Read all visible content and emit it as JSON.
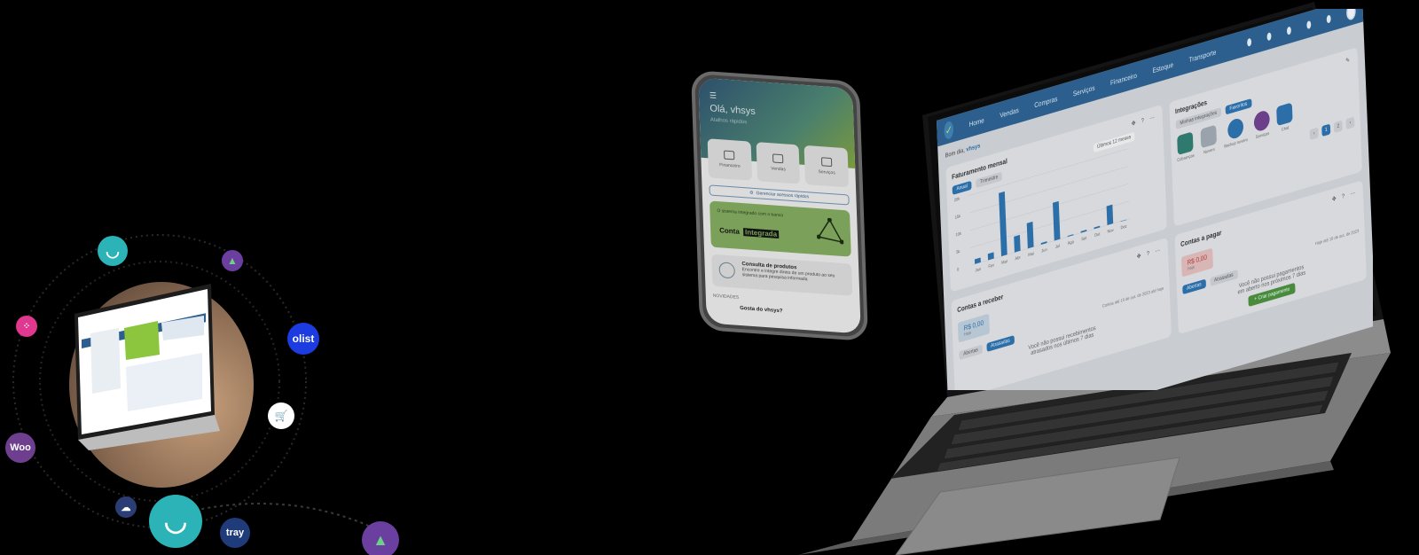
{
  "left_cluster": {
    "badges": [
      {
        "name": "unico-small-badge",
        "label": "",
        "color": "#2bb3b8"
      },
      {
        "name": "green-arrow-small-badge",
        "label": "",
        "color": "#6b3fa0"
      },
      {
        "name": "pink-dots-badge",
        "label": "",
        "color": "#e0388f"
      },
      {
        "name": "olist-badge",
        "label": "olist",
        "color": "#1c3be0"
      },
      {
        "name": "cart-badge",
        "label": "",
        "color": "#ffffff"
      },
      {
        "name": "woo-badge",
        "label": "Woo",
        "color": "#6f3f8f"
      },
      {
        "name": "cloud-badge",
        "label": "",
        "color": "#2b3d75"
      },
      {
        "name": "unico-large-badge",
        "label": "",
        "color": "#2bb3b8"
      },
      {
        "name": "tray-badge",
        "label": "tray",
        "color": "#1f3b7a"
      },
      {
        "name": "green-arrow-large-badge",
        "label": "",
        "color": "#6b3fa0"
      }
    ]
  },
  "phone": {
    "greeting": "Olá, vhsys",
    "subtitle": "Atalhos rápidos",
    "tiles": [
      "Financeiro",
      "Vendas",
      "Serviços"
    ],
    "shortcut_button": "Gerenciar acessos rápidos",
    "banner_small": "O sistema integrado com o banco",
    "banner_big_prefix": "Conta",
    "banner_big_highlight": "Integrada",
    "card_title": "Consulta de produtos",
    "card_text": "Encontre e integre direto de um produto ao seu sistema para pesquisa informada",
    "footer_label": "NOVIDADES",
    "footer_title": "Gosta do vhsys?"
  },
  "laptop": {
    "nav": [
      "Home",
      "Vendas",
      "Compras",
      "Serviços",
      "Financeiro",
      "Estoque",
      "Transporte"
    ],
    "greeting_prefix": "Bom dia,",
    "greeting_name": "vhsys",
    "billing": {
      "title": "Faturamento mensal",
      "filter": "Últimos 12 meses",
      "tabs": [
        "Anual",
        "Trimestre"
      ],
      "y_ticks": [
        "20k",
        "15k",
        "10k",
        "5k",
        "0"
      ],
      "x_ticks": [
        "Jan",
        "Fev",
        "Mar",
        "Abr",
        "Mai",
        "Jun",
        "Jul",
        "Ago",
        "Set",
        "Out",
        "Nov",
        "Dez"
      ]
    },
    "integrations": {
      "title": "Integrações",
      "tabs": [
        "Minhas integrações",
        "Favoritos"
      ],
      "items": [
        "Cobranças",
        "Nuvem",
        "Backup nuvem",
        "Serviços",
        "Chat"
      ],
      "pages": [
        "1",
        "2"
      ]
    },
    "receivables": {
      "title": "Contas a receber",
      "value": "R$ 0,00",
      "value_label": "Hoje",
      "tabs": [
        "Abertas",
        "Atrasadas"
      ],
      "period": "Contas até 19 de out. de 2023 até hoje",
      "empty_line1": "Você não possui recebimentos",
      "empty_line2": "atrasados nos últimos 7 dias"
    },
    "payables": {
      "title": "Contas a pagar",
      "value": "R$ 0,00",
      "value_label": "Hoje",
      "tabs": [
        "Abertas",
        "Atrasadas"
      ],
      "period": "Hoje até 19 de out. de 2023",
      "empty_line1": "Você não possui pagamentos",
      "empty_line2": "em aberto nos próximos 7 dias",
      "create_button": "+ Criar pagamento"
    }
  },
  "chart_data": {
    "type": "bar",
    "categories": [
      "Jan",
      "Fev",
      "Mar",
      "Abr",
      "Mai",
      "Jun",
      "Jul",
      "Ago",
      "Set",
      "Out",
      "Nov",
      "Dez"
    ],
    "values": [
      1500,
      2000,
      20000,
      5000,
      8000,
      500,
      12000,
      300,
      500,
      500,
      6000,
      0
    ],
    "title": "Faturamento mensal",
    "ylim": [
      0,
      22000
    ]
  }
}
